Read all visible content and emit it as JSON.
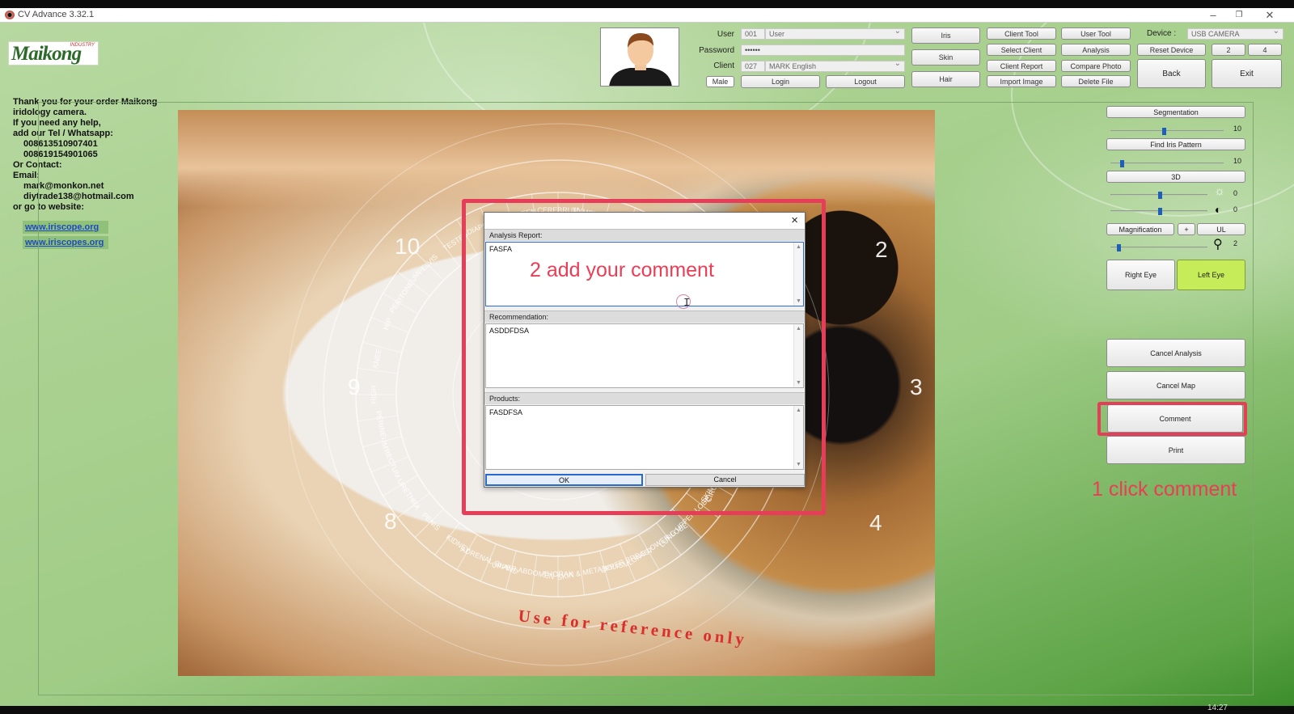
{
  "window": {
    "title": "CV Advance 3.32.1",
    "controls": {
      "minimize": "–",
      "restore": "❐",
      "close": "✕"
    }
  },
  "logo": {
    "text": "Maikong",
    "sub": "INDUSTRY"
  },
  "contact": {
    "lines": [
      "Thank you for your order Maikong",
      "iridology camera.",
      "If you need any help,",
      "add our  Tel / Whatsapp:",
      "008613510907401",
      "008619154901065",
      "Or Contact:",
      "Email:",
      "mark@monkon.net",
      "diytrade138@hotmail.com",
      "or go to website:"
    ],
    "links": [
      "www.iriscope.org",
      "www.iriscopes.org"
    ]
  },
  "login": {
    "user_label": "User",
    "user_id": "001",
    "user_value": "User",
    "password_label": "Password",
    "password_value": "••••••",
    "client_label": "Client",
    "client_id": "027",
    "client_value": "MARK English",
    "gender_button": "Male",
    "login_button": "Login",
    "logout_button": "Logout"
  },
  "tabs": {
    "iris": "Iris",
    "skin": "Skin",
    "hair": "Hair"
  },
  "tools": {
    "client_tool": "Client Tool",
    "select_client": "Select Client",
    "client_report": "Client Report",
    "import_image": "Import Image",
    "user_tool": "User Tool",
    "analysis": "Analysis",
    "compare_photo": "Compare Photo",
    "delete_file": "Delete File"
  },
  "device": {
    "label": "Device :",
    "value": "USB CAMERA",
    "reset": "Reset Device",
    "layout_2": "2",
    "layout_4": "4",
    "back": "Back",
    "exit": "Exit"
  },
  "right_panel": {
    "segmentation": "Segmentation",
    "segmentation_value": "10",
    "find_iris": "Find Iris Pattern",
    "find_iris_value": "10",
    "threed": "3D",
    "brightness_value": "0",
    "contrast_value": "0",
    "magnification": "Magnification",
    "mag_plus": "+",
    "mag_ul": "UL",
    "mag_value": "2",
    "right_eye": "Right Eye",
    "left_eye": "Left Eye",
    "cancel_analysis": "Cancel Analysis",
    "cancel_map": "Cancel Map",
    "comment": "Comment",
    "print": "Print"
  },
  "iris_chart": {
    "reference": "Use for reference only",
    "clock_numbers": [
      "10",
      "2",
      "9",
      "3",
      "8",
      "4"
    ],
    "zones": [
      "CEREBRUM",
      "LYMPHATIC",
      "NECK",
      "THROAT",
      "THYROID",
      "ESOPHAGUS",
      "CERVICAL",
      "SHOULDER",
      "UPPER BACK",
      "LOWER BACK",
      "CIRCULATORY SYSTEM",
      "SKIN",
      "LUNG UPPER LOBE",
      "LUNG LOWER LOBE",
      "UPPER BREAST",
      "SKIN & METABOLISM",
      "THORAX",
      "UPPER ABDOMEN",
      "ADRENAL GLAND",
      "KIDNEY",
      "PENIS",
      "URETHRA",
      "RECTUM",
      "PERINEUM",
      "HIGH",
      "KNEE",
      "HIP",
      "PERITONEUM",
      "PELVIS",
      "TESTES",
      "DIAPHRAGM",
      "SPLEEN"
    ]
  },
  "dialog": {
    "close": "×",
    "analysis_label": "Analysis Report:",
    "analysis_text": "FASFA",
    "recommendation_label": "Recommendation:",
    "recommendation_text": "ASDDFDSA",
    "products_label": "Products:",
    "products_text": "FASDFSA",
    "ok": "OK",
    "cancel": "Cancel"
  },
  "annotations": {
    "step1": "1 click comment",
    "step2": "2 add your comment"
  },
  "taskbar": {
    "time": "14:27"
  },
  "colors": {
    "annotation": "#e63e58",
    "left_eye_active": "#c6ec5a",
    "bg_green": "#a9d08f"
  }
}
